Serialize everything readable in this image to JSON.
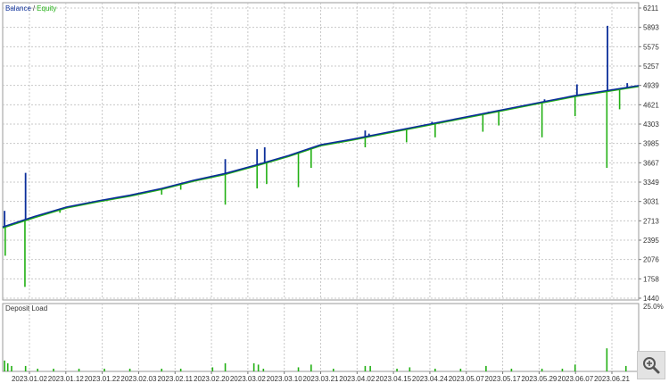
{
  "chart_data": [
    {
      "type": "line",
      "title": "",
      "legend": [
        "Balance",
        "Equity"
      ],
      "legend_separator": "/",
      "legend_position": "top-left",
      "colors": {
        "Balance": "#0b2e9a",
        "Equity": "#22b014"
      },
      "grid": true,
      "x_tick_labels": [
        "2023.01.02",
        "2023.01.12",
        "2023.01.22",
        "2023.02.03",
        "2023.02.11",
        "2023.02.20",
        "2023.03.02",
        "2023.03.10",
        "2023.03.21",
        "2023.04.02",
        "2023.04.15",
        "2023.04.24",
        "2023.05.07",
        "2023.05.17",
        "2023.05.29",
        "2023.06.07",
        "2023.06.21"
      ],
      "y_tick_labels": [
        "6211",
        "5893",
        "5575",
        "5257",
        "4939",
        "4621",
        "4303",
        "3985",
        "3667",
        "3349",
        "3031",
        "2713",
        "2395",
        "2076",
        "1758",
        "1440"
      ],
      "ylim": [
        1440,
        6211
      ],
      "xlim": [
        0,
        100
      ],
      "series": [
        {
          "name": "Balance",
          "x": [
            0,
            5,
            10,
            15,
            20,
            25,
            30,
            35,
            40,
            45,
            50,
            55,
            60,
            65,
            70,
            75,
            80,
            85,
            90,
            95,
            100
          ],
          "values": [
            2610,
            2780,
            2930,
            3030,
            3120,
            3230,
            3360,
            3470,
            3610,
            3760,
            3930,
            4020,
            4120,
            4220,
            4320,
            4420,
            4520,
            4620,
            4720,
            4800,
            4880
          ]
        },
        {
          "name": "Equity",
          "x": [
            0,
            5,
            10,
            15,
            20,
            25,
            30,
            35,
            40,
            45,
            50,
            55,
            60,
            65,
            70,
            75,
            80,
            85,
            90,
            95,
            100
          ],
          "values": [
            2600,
            2765,
            2920,
            3020,
            3110,
            3220,
            3350,
            3460,
            3600,
            3750,
            3920,
            4010,
            4110,
            4210,
            4310,
            4410,
            4510,
            4610,
            4710,
            4790,
            4870
          ]
        }
      ],
      "balance_spikes": [
        {
          "x": 0.3,
          "value": 2870
        },
        {
          "x": 3.6,
          "value": 3480
        },
        {
          "x": 35.0,
          "value": 3700
        },
        {
          "x": 40.0,
          "value": 3860
        },
        {
          "x": 41.2,
          "value": 3890
        },
        {
          "x": 57.0,
          "value": 4160
        },
        {
          "x": 57.6,
          "value": 4110
        },
        {
          "x": 64.0,
          "value": 4190
        },
        {
          "x": 67.5,
          "value": 4300
        },
        {
          "x": 76.4,
          "value": 4460
        },
        {
          "x": 85.2,
          "value": 4660
        },
        {
          "x": 90.3,
          "value": 4900
        },
        {
          "x": 95.1,
          "value": 5840
        },
        {
          "x": 98.2,
          "value": 4920
        }
      ],
      "equity_drops": [
        {
          "x": 0.4,
          "value": 2150
        },
        {
          "x": 3.5,
          "value": 1650
        },
        {
          "x": 9.0,
          "value": 2840
        },
        {
          "x": 25.0,
          "value": 3130
        },
        {
          "x": 28.0,
          "value": 3210
        },
        {
          "x": 35.0,
          "value": 2970
        },
        {
          "x": 40.0,
          "value": 3230
        },
        {
          "x": 41.5,
          "value": 3300
        },
        {
          "x": 46.5,
          "value": 3250
        },
        {
          "x": 48.5,
          "value": 3560
        },
        {
          "x": 57.0,
          "value": 3890
        },
        {
          "x": 63.5,
          "value": 3970
        },
        {
          "x": 68.0,
          "value": 4050
        },
        {
          "x": 75.5,
          "value": 4140
        },
        {
          "x": 78.0,
          "value": 4240
        },
        {
          "x": 84.8,
          "value": 4050
        },
        {
          "x": 90.0,
          "value": 4390
        },
        {
          "x": 95.0,
          "value": 3560
        },
        {
          "x": 97.0,
          "value": 4500
        }
      ]
    },
    {
      "type": "bar",
      "legend": [
        "Deposit Load"
      ],
      "y_tick_labels": [
        "25.0%",
        "0.0%"
      ],
      "ylim": [
        0,
        25
      ],
      "xlim": [
        0,
        100
      ],
      "colors": {
        "Deposit Load": "#22b014"
      },
      "x": [
        0.3,
        0.8,
        1.4,
        3.6,
        5.5,
        8.0,
        12.0,
        16.0,
        20.0,
        25.0,
        28.0,
        33.0,
        35.0,
        39.5,
        40.2,
        41.0,
        46.5,
        48.5,
        52.0,
        57.0,
        57.8,
        62.0,
        64.0,
        68.0,
        72.0,
        76.0,
        80.0,
        84.8,
        88.0,
        90.0,
        95.0,
        98.0
      ],
      "values": [
        4,
        3,
        2,
        2,
        1,
        1,
        1,
        1,
        1,
        1,
        1,
        1.5,
        3,
        3,
        2.5,
        1,
        1.5,
        2.5,
        1,
        2,
        2,
        1,
        1.5,
        1,
        1,
        2,
        1,
        1,
        1,
        2.5,
        8.5,
        2
      ]
    }
  ]
}
